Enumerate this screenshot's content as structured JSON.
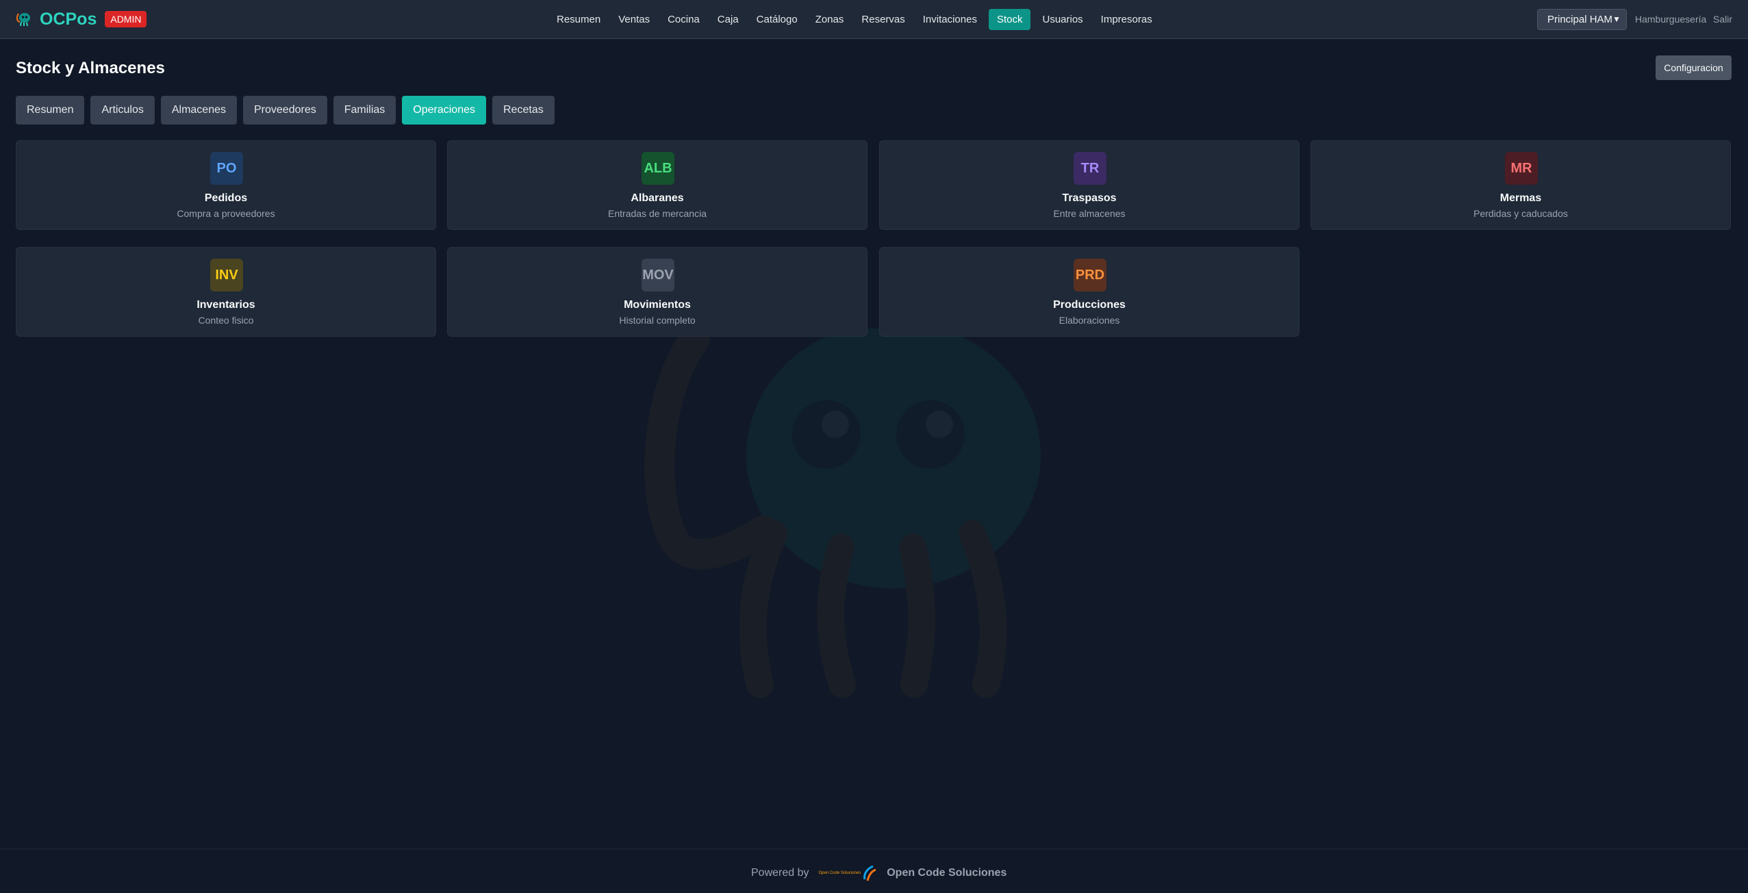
{
  "app": {
    "name": "OCPos",
    "badge": "ADMIN"
  },
  "nav": {
    "items": [
      {
        "label": "Resumen"
      },
      {
        "label": "Ventas"
      },
      {
        "label": "Cocina"
      },
      {
        "label": "Caja"
      },
      {
        "label": "Catálogo"
      },
      {
        "label": "Zonas"
      },
      {
        "label": "Reservas"
      },
      {
        "label": "Invitaciones"
      },
      {
        "label": "Stock",
        "active": true
      },
      {
        "label": "Usuarios"
      },
      {
        "label": "Impresoras"
      }
    ],
    "store_select": "Principal HAM",
    "user": "Hamburguesería",
    "logout": "Salir"
  },
  "page": {
    "title": "Stock y Almacenes",
    "config_button": "Configuracion"
  },
  "tabs": [
    {
      "label": "Resumen"
    },
    {
      "label": "Articulos"
    },
    {
      "label": "Almacenes"
    },
    {
      "label": "Proveedores"
    },
    {
      "label": "Familias"
    },
    {
      "label": "Operaciones",
      "active": true
    },
    {
      "label": "Recetas"
    }
  ],
  "cards": [
    {
      "code": "PO",
      "title": "Pedidos",
      "subtitle": "Compra a proveedores",
      "color": "#60a5fa",
      "bg": "#1e3a5f"
    },
    {
      "code": "ALB",
      "title": "Albaranes",
      "subtitle": "Entradas de mercancia",
      "color": "#4ade80",
      "bg": "#14532d"
    },
    {
      "code": "TR",
      "title": "Traspasos",
      "subtitle": "Entre almacenes",
      "color": "#a78bfa",
      "bg": "#3b2a63"
    },
    {
      "code": "MR",
      "title": "Mermas",
      "subtitle": "Perdidas y caducados",
      "color": "#f87171",
      "bg": "#4c1d24"
    },
    {
      "code": "INV",
      "title": "Inventarios",
      "subtitle": "Conteo fisico",
      "color": "#facc15",
      "bg": "#4a4420"
    },
    {
      "code": "MOV",
      "title": "Movimientos",
      "subtitle": "Historial completo",
      "color": "#9ca3af",
      "bg": "#374151"
    },
    {
      "code": "PRD",
      "title": "Producciones",
      "subtitle": "Elaboraciones",
      "color": "#fb923c",
      "bg": "#5a3020"
    }
  ],
  "footer": {
    "powered_by": "Powered by",
    "logo_text": "Open Code Soluciones",
    "company": "Open Code Soluciones"
  },
  "icons": {
    "brand": "octopus-logo-icon",
    "select": "chevron-down-icon",
    "watermark": "octopus-watermark-icon"
  }
}
